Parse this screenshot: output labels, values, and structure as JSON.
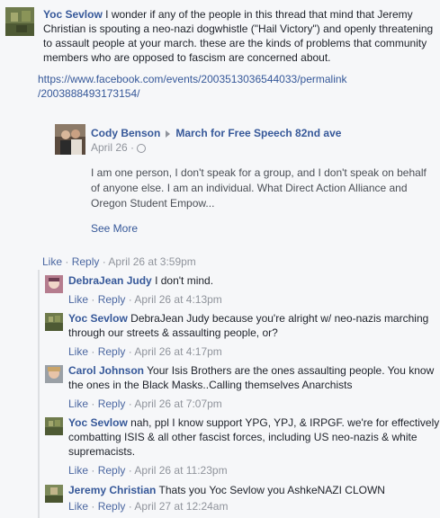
{
  "top_comment": {
    "author": "Yoc Sevlow",
    "text": "I wonder if any of the people in this thread that mind that Jeremy Christian is spouting a neo-nazi dogwhistle (\"Hail Victory\") and openly threatening to assault people at your march. these are the kinds of problems that community members who are opposed to fascism are concerned about.",
    "link_line1": "https://www.facebook.com/events/2003513036544033/permalink",
    "link_line2": "/2003888493173154/",
    "like_label": "Like",
    "reply_label": "Reply",
    "timestamp": "April 26 at 3:59pm"
  },
  "shared_post": {
    "author": "Cody Benson",
    "target": "March for Free Speech 82nd ave",
    "date": "April 26 ·",
    "body": "I am one person, I don't speak for a group, and I don't speak on behalf of anyone else. I am an individual. What Direct Action Alliance and Oregon Student Empow...",
    "see_more": "See More"
  },
  "replies": [
    {
      "author": "DebraJean Judy",
      "text": "I don't mind.",
      "like_label": "Like",
      "reply_label": "Reply",
      "timestamp": "April 26 at 4:13pm"
    },
    {
      "author": "Yoc Sevlow",
      "text": "DebraJean Judy because you're alright w/ neo-nazis marching through our streets & assaulting people, or?",
      "like_label": "Like",
      "reply_label": "Reply",
      "timestamp": "April 26 at 4:17pm"
    },
    {
      "author": "Carol Johnson",
      "text": "Your Isis Brothers are the ones assaulting people. You know the ones in the Black Masks..Calling themselves Anarchists",
      "like_label": "Like",
      "reply_label": "Reply",
      "timestamp": "April 26 at 7:07pm"
    },
    {
      "author": "Yoc Sevlow",
      "text": "nah, ppl I know support YPG, YPJ, & IRPGF. we're for effectively combatting ISIS & all other fascist forces, including US neo-nazis & white supremacists.",
      "like_label": "Like",
      "reply_label": "Reply",
      "timestamp": "April 26 at 11:23pm"
    },
    {
      "author": "Jeremy Christian",
      "text": "Thats you Yoc Sevlow you AshkeNAZI CLOWN",
      "like_label": "Like",
      "reply_label": "Reply",
      "timestamp": "April 27 at 12:24am"
    }
  ],
  "separator": "·"
}
